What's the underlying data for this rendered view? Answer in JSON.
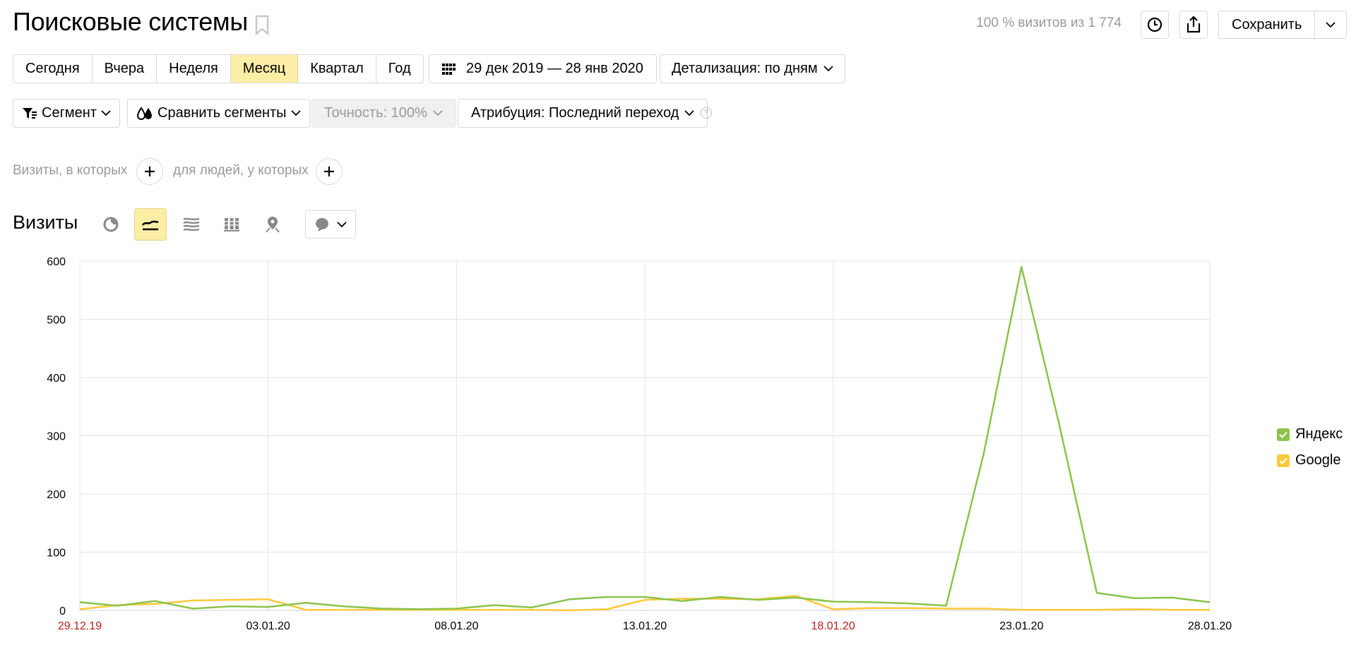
{
  "header": {
    "title": "Поисковые системы",
    "visits_info": "100 % визитов из 1 774",
    "save_label": "Сохранить"
  },
  "periods": [
    "Сегодня",
    "Вчера",
    "Неделя",
    "Месяц",
    "Квартал",
    "Год"
  ],
  "active_period": "Месяц",
  "date_range": "29 дек 2019 — 28 янв 2020",
  "detail": "Детализация: по дням",
  "filters": {
    "segment": "Сегмент",
    "compare": "Сравнить сегменты",
    "accuracy": "Точность: 100%",
    "attribution": "Атрибуция: Последний переход",
    "help": "?"
  },
  "conditions": {
    "visits_where": "Визиты, в которых",
    "people_where": "для людей, у которых"
  },
  "chart_section": {
    "title": "Визиты",
    "icons": [
      "pie-chart-icon",
      "line-chart-icon",
      "area-chart-icon",
      "bar-chart-icon",
      "map-pin-icon",
      "comment-icon"
    ]
  },
  "colors": {
    "yandex": "#8bc34a",
    "google": "#fcc93a",
    "accent": "#fdeea6",
    "holiday": "#b71c1c"
  },
  "chart_data": {
    "type": "line",
    "ylim": [
      0,
      600
    ],
    "yticks": [
      0,
      100,
      200,
      300,
      400,
      500,
      600
    ],
    "x": [
      "29.12.19",
      "30.12.19",
      "31.12.19",
      "01.01.20",
      "02.01.20",
      "03.01.20",
      "04.01.20",
      "05.01.20",
      "06.01.20",
      "07.01.20",
      "08.01.20",
      "09.01.20",
      "10.01.20",
      "11.01.20",
      "12.01.20",
      "13.01.20",
      "14.01.20",
      "15.01.20",
      "16.01.20",
      "17.01.20",
      "18.01.20",
      "19.01.20",
      "20.01.20",
      "21.01.20",
      "22.01.20",
      "23.01.20",
      "24.01.20",
      "25.01.20",
      "26.01.20",
      "27.01.20",
      "28.01.20"
    ],
    "xtick_labels": [
      {
        "label": "29.12.19",
        "holiday": true
      },
      {
        "label": "03.01.20",
        "holiday": false
      },
      {
        "label": "08.01.20",
        "holiday": false
      },
      {
        "label": "13.01.20",
        "holiday": false
      },
      {
        "label": "18.01.20",
        "holiday": true
      },
      {
        "label": "23.01.20",
        "holiday": false
      },
      {
        "label": "28.01.20",
        "holiday": false
      }
    ],
    "series": [
      {
        "name": "Яндекс",
        "color": "#8bc34a",
        "values": [
          14,
          8,
          16,
          3,
          7,
          6,
          13,
          7,
          3,
          2,
          3,
          9,
          5,
          19,
          23,
          23,
          16,
          23,
          18,
          22,
          15,
          14,
          12,
          8,
          270,
          590,
          320,
          30,
          21,
          22,
          14
        ]
      },
      {
        "name": "Google",
        "color": "#fcc93a",
        "values": [
          2,
          9,
          11,
          17,
          18,
          19,
          1,
          1,
          1,
          1,
          1,
          1,
          1,
          0,
          2,
          18,
          20,
          20,
          19,
          25,
          2,
          4,
          4,
          3,
          3,
          1,
          1,
          1,
          2,
          1,
          1
        ]
      }
    ],
    "legend": "right"
  }
}
